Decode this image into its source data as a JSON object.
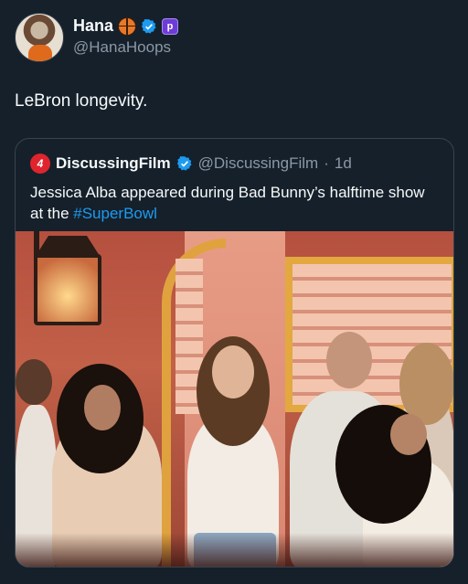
{
  "author": {
    "display_name": "Hana",
    "handle": "@HanaHoops",
    "badges": [
      "basketball-icon",
      "verified-icon",
      "subscriber-badge-icon"
    ],
    "badge_glyph": "p"
  },
  "tweet": {
    "text": "LeBron longevity."
  },
  "quoted": {
    "logo_glyph": "4",
    "display_name": "DiscussingFilm",
    "handle": "@DiscussingFilm",
    "separator": "·",
    "time": "1d",
    "text_before": "Jessica Alba appeared during Bad Bunny’s halftime show at the ",
    "hashtag": "#SuperBowl",
    "media_description_icon": "photo"
  },
  "colors": {
    "background": "#15202b",
    "accent": "#1d9bf0",
    "verified": "#1d9bf0",
    "muted_text": "#8b98a5",
    "brand_red": "#e0242e"
  }
}
